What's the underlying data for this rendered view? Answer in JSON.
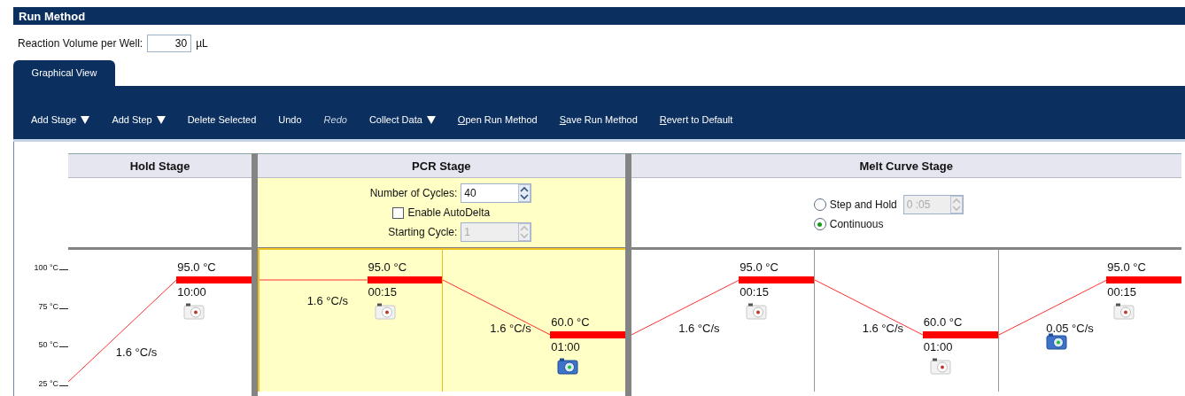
{
  "window": {
    "title": "Run Method"
  },
  "reaction_volume": {
    "label": "Reaction Volume per Well:",
    "value": "30",
    "unit": "µL"
  },
  "tabs": [
    {
      "label": "Graphical View",
      "selected": true
    }
  ],
  "toolbar": [
    {
      "label": "Add Stage",
      "menu": true,
      "mnemonic": false,
      "disabled": false
    },
    {
      "label": "Add Step",
      "menu": true,
      "mnemonic": false,
      "disabled": false
    },
    {
      "label": "Delete Selected",
      "menu": false,
      "mnemonic": false,
      "disabled": false
    },
    {
      "label": "Undo",
      "menu": false,
      "mnemonic": false,
      "disabled": false
    },
    {
      "label": "Redo",
      "menu": false,
      "mnemonic": false,
      "disabled": true
    },
    {
      "label": "Collect Data",
      "menu": true,
      "mnemonic": false,
      "disabled": false
    },
    {
      "label": "Open Run Method",
      "menu": false,
      "mnemonic": true,
      "disabled": false
    },
    {
      "label": "Save Run Method",
      "menu": false,
      "mnemonic": true,
      "disabled": false
    },
    {
      "label": "Revert to Default",
      "menu": false,
      "mnemonic": true,
      "disabled": false
    }
  ],
  "axis": {
    "ticks": [
      "100 °C",
      "75 °C",
      "50 °C",
      "25 °C"
    ]
  },
  "stages": [
    {
      "kind": "hold",
      "title": "Hold Stage",
      "selected": false,
      "steps": [
        {
          "temperature": "95.0 °C",
          "time": "10:00",
          "ramp_rate": "1.6 °C/s",
          "collect": false,
          "ramp_collect": false
        }
      ]
    },
    {
      "kind": "pcr",
      "title": "PCR Stage",
      "selected": true,
      "settings": {
        "cycles_label": "Number of Cycles:",
        "cycles": "40",
        "autodelta_label": "Enable AutoDelta",
        "autodelta_checked": false,
        "starting_cycle_label": "Starting Cycle:",
        "starting_cycle": "1",
        "starting_cycle_disabled": true
      },
      "steps": [
        {
          "temperature": "95.0 °C",
          "time": "00:15",
          "ramp_rate": "1.6 °C/s",
          "collect": false,
          "ramp_collect": false
        },
        {
          "temperature": "60.0 °C",
          "time": "01:00",
          "ramp_rate": "1.6 °C/s",
          "collect": true,
          "ramp_collect": false
        }
      ]
    },
    {
      "kind": "melt",
      "title": "Melt Curve Stage",
      "selected": false,
      "settings": {
        "modes": [
          {
            "label": "Step and Hold",
            "selected": false,
            "hold_time": {
              "value": "0 :05",
              "disabled": true
            }
          },
          {
            "label": "Continuous",
            "selected": true
          }
        ]
      },
      "steps": [
        {
          "temperature": "95.0 °C",
          "time": "00:15",
          "ramp_rate": "1.6 °C/s",
          "collect": false,
          "ramp_collect": false
        },
        {
          "temperature": "60.0 °C",
          "time": "01:00",
          "ramp_rate": "1.6 °C/s",
          "collect": false,
          "ramp_collect": false
        },
        {
          "temperature": "95.0 °C",
          "time": "00:15",
          "ramp_rate": "0.05 °C/s",
          "collect": false,
          "ramp_collect": true
        }
      ]
    }
  ]
}
